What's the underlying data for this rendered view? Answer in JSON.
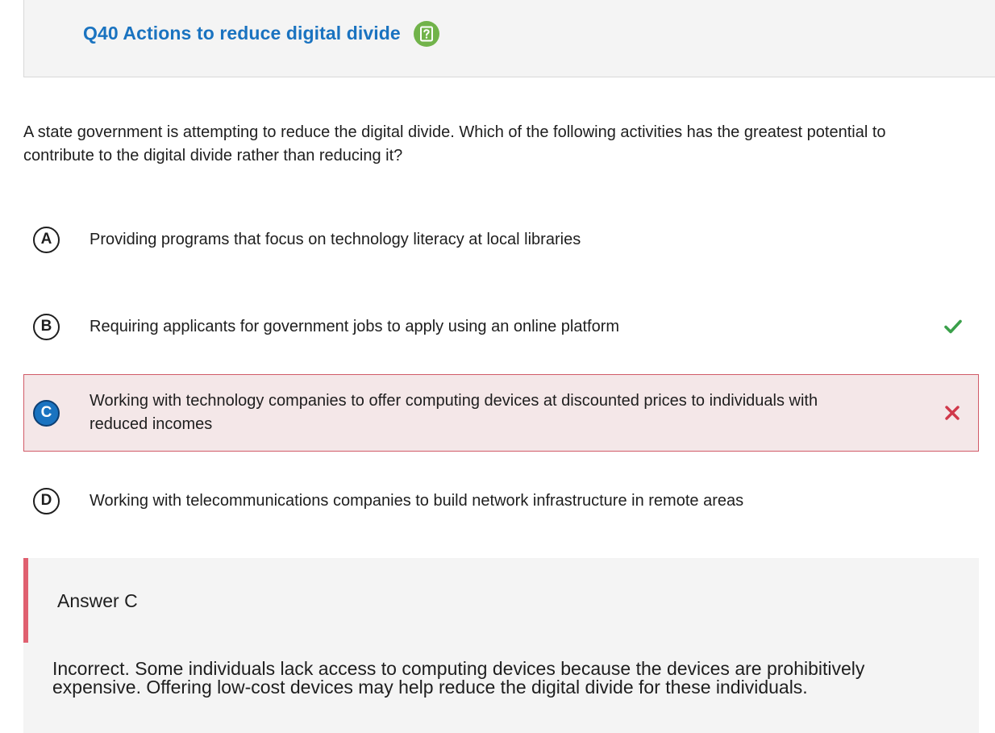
{
  "header": {
    "title": "Q40 Actions to reduce digital divide",
    "help_icon": "help-question-icon"
  },
  "question": {
    "text": "A state government is attempting to reduce the digital divide. Which of the following activities has the greatest potential to contribute to the digital divide rather than reducing it?"
  },
  "options": [
    {
      "letter": "A",
      "text": "Providing programs that focus on technology literacy at local libraries",
      "status": "none"
    },
    {
      "letter": "B",
      "text": "Requiring applicants for government jobs to apply using an online platform",
      "status": "correct",
      "icon": "checkmark-icon"
    },
    {
      "letter": "C",
      "text": "Working with technology companies to offer computing devices at discounted prices to individuals with reduced incomes",
      "status": "selected-incorrect",
      "icon": "x-mark-icon"
    },
    {
      "letter": "D",
      "text": "Working with telecommunications companies to build network infrastructure in remote areas",
      "status": "none"
    }
  ],
  "answer": {
    "title": "Answer C",
    "feedback": "Incorrect. Some individuals lack access to computing devices because the devices are prohibitively expensive. Offering low-cost devices may help reduce the digital divide for these individuals."
  },
  "colors": {
    "title_blue": "#1a73c0",
    "help_green": "#71b34a",
    "correct_green": "#3aa04a",
    "incorrect_red": "#d0384a",
    "selected_bg": "#f4e7e8",
    "panel_bg": "#f4f4f4"
  }
}
